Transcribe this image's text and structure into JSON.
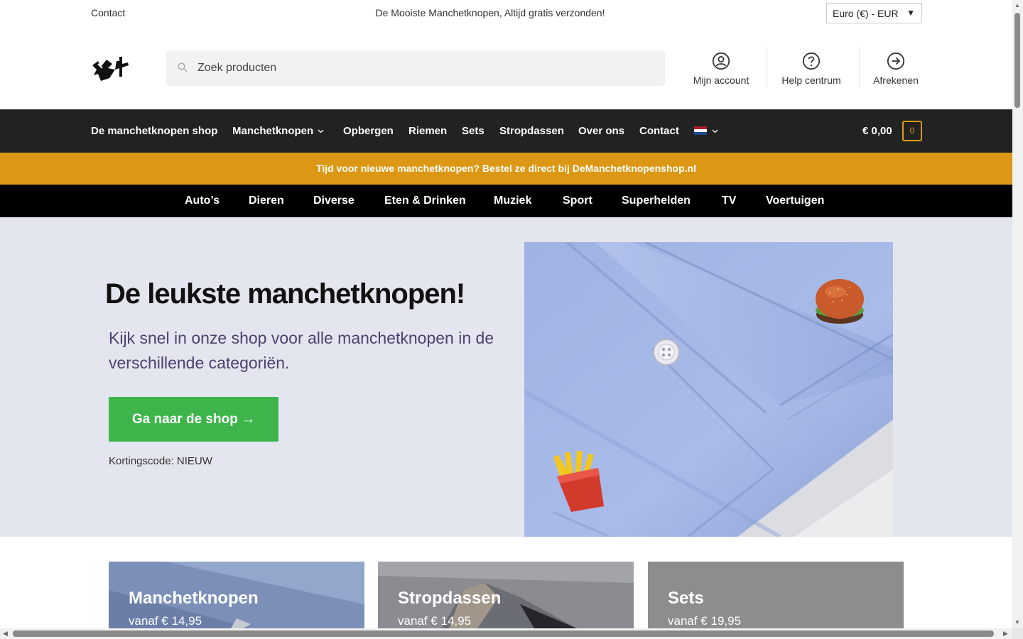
{
  "topbar": {
    "contact": "Contact",
    "promo": "De Mooiste Manchetknopen, Altijd gratis verzonden!",
    "currency": "Euro (€) - EUR"
  },
  "header": {
    "search_placeholder": "Zoek producten",
    "links": [
      {
        "label": "Mijn account",
        "icon": "user-icon"
      },
      {
        "label": "Help centrum",
        "icon": "question-icon"
      },
      {
        "label": "Afrekenen",
        "icon": "arrow-right-icon"
      }
    ]
  },
  "nav": {
    "items": [
      "De manchetknopen shop",
      "Manchetknopen",
      "Opbergen",
      "Riemen",
      "Sets",
      "Stropdassen",
      "Over ons",
      "Contact"
    ],
    "cart_total": "€ 0,00",
    "cart_count": "0"
  },
  "announcement": "Tijd voor nieuwe manchetknopen? Bestel ze direct bij DeManchetknopenshop.nl",
  "categories": [
    "Auto’s",
    "Dieren",
    "Diverse",
    "Eten & Drinken",
    "Muziek",
    "Sport",
    "Superhelden",
    "TV",
    "Voertuigen"
  ],
  "hero": {
    "title": "De leukste manchetknopen!",
    "lead": "Kijk snel in onze shop voor alle manchetknopen in de verschillende categoriën.",
    "cta": "Ga naar de shop →",
    "code": "Kortingscode: NIEUW"
  },
  "cards": [
    {
      "title": "Manchetknopen",
      "price": "vanaf € 14,95"
    },
    {
      "title": "Stropdassen",
      "price": "vanaf € 14,95"
    },
    {
      "title": "Sets",
      "price": "vanaf € 19,95"
    }
  ],
  "colors": {
    "nav_bg": "#222222",
    "announcement_bg": "#dc9814",
    "hero_bg": "#e3e6ee",
    "cta_bg": "#3db54a",
    "accent": "#d99b1a"
  }
}
